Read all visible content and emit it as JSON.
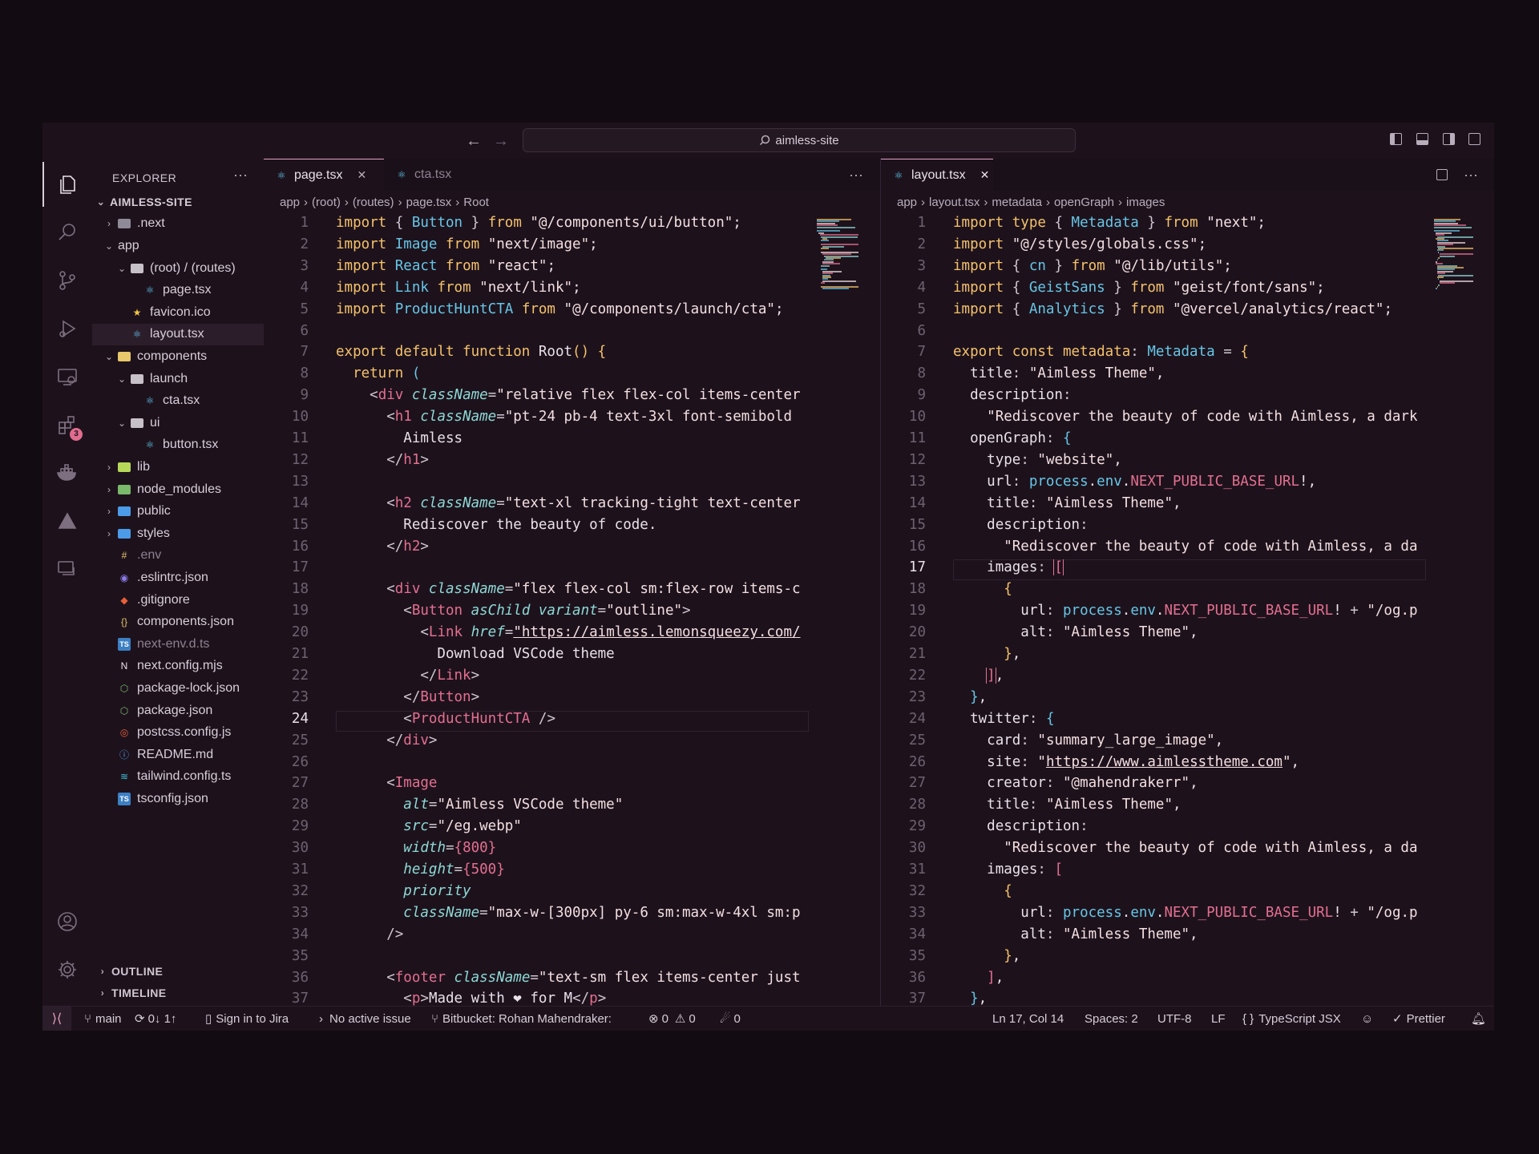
{
  "window": {
    "search_text": "aimless-site"
  },
  "explorer": {
    "title": "EXPLORER",
    "root": "AIMLESS-SITE",
    "outline": "OUTLINE",
    "timeline": "TIMELINE",
    "items": [
      {
        "label": ".next",
        "depth": 0,
        "chev": "›",
        "icon": "folder",
        "color": "#8e8a98"
      },
      {
        "label": "app",
        "depth": 0,
        "chev": "⌄",
        "icon": "none",
        "color": ""
      },
      {
        "label": "(root) / (routes)",
        "depth": 1,
        "chev": "⌄",
        "icon": "folder",
        "color": "#c8c0c8"
      },
      {
        "label": "page.tsx",
        "depth": 2,
        "chev": "",
        "icon": "react",
        "color": "#61c3e8"
      },
      {
        "label": "favicon.ico",
        "depth": 1,
        "chev": "",
        "icon": "star",
        "color": "#f5c542"
      },
      {
        "label": "layout.tsx",
        "depth": 1,
        "chev": "",
        "icon": "react",
        "color": "#61c3e8",
        "selected": true
      },
      {
        "label": "components",
        "depth": 0,
        "chev": "⌄",
        "icon": "folder",
        "color": "#e8c86a"
      },
      {
        "label": "launch",
        "depth": 1,
        "chev": "⌄",
        "icon": "folder",
        "color": "#c8c0c8"
      },
      {
        "label": "cta.tsx",
        "depth": 2,
        "chev": "",
        "icon": "react",
        "color": "#61c3e8"
      },
      {
        "label": "ui",
        "depth": 1,
        "chev": "⌄",
        "icon": "folder",
        "color": "#c8c0c8"
      },
      {
        "label": "button.tsx",
        "depth": 2,
        "chev": "",
        "icon": "react",
        "color": "#61c3e8"
      },
      {
        "label": "lib",
        "depth": 0,
        "chev": "›",
        "icon": "folder",
        "color": "#b6d85a"
      },
      {
        "label": "node_modules",
        "depth": 0,
        "chev": "›",
        "icon": "folder",
        "color": "#7ab86a"
      },
      {
        "label": "public",
        "depth": 0,
        "chev": "›",
        "icon": "folder",
        "color": "#4c9be8"
      },
      {
        "label": "styles",
        "depth": 0,
        "chev": "›",
        "icon": "folder",
        "color": "#4c9be8"
      },
      {
        "label": ".env",
        "depth": 0,
        "chev": "",
        "icon": "hash",
        "color": "#e8c86a",
        "dim": true
      },
      {
        "label": ".eslintrc.json",
        "depth": 0,
        "chev": "",
        "icon": "circle",
        "color": "#8a7ce8"
      },
      {
        "label": ".gitignore",
        "depth": 0,
        "chev": "",
        "icon": "diamond",
        "color": "#e8603a"
      },
      {
        "label": "components.json",
        "depth": 0,
        "chev": "",
        "icon": "braces",
        "color": "#e8c86a"
      },
      {
        "label": "next-env.d.ts",
        "depth": 0,
        "chev": "",
        "icon": "ts",
        "color": "#3b7fc4",
        "dim": true
      },
      {
        "label": "next.config.mjs",
        "depth": 0,
        "chev": "",
        "icon": "n",
        "color": "#e8e0ea"
      },
      {
        "label": "package-lock.json",
        "depth": 0,
        "chev": "",
        "icon": "node",
        "color": "#7ab86a"
      },
      {
        "label": "package.json",
        "depth": 0,
        "chev": "",
        "icon": "node",
        "color": "#7ab86a"
      },
      {
        "label": "postcss.config.js",
        "depth": 0,
        "chev": "",
        "icon": "postcss",
        "color": "#e8603a"
      },
      {
        "label": "README.md",
        "depth": 0,
        "chev": "",
        "icon": "info",
        "color": "#4c9be8"
      },
      {
        "label": "tailwind.config.ts",
        "depth": 0,
        "chev": "",
        "icon": "wave",
        "color": "#3bc0d8"
      },
      {
        "label": "tsconfig.json",
        "depth": 0,
        "chev": "",
        "icon": "ts",
        "color": "#3b7fc4"
      }
    ]
  },
  "activity": {
    "badge_count": "3"
  },
  "left_editor": {
    "tabs": [
      {
        "label": "page.tsx",
        "active": true
      },
      {
        "label": "cta.tsx",
        "active": false
      }
    ],
    "breadcrumb": [
      "app",
      "(root)",
      "(routes)",
      "page.tsx",
      "Root"
    ],
    "current_line": 24,
    "lines": [
      "<span class=\"k\">import</span> <span class=\"p\">{</span> <span class=\"i\">Button</span> <span class=\"p\">}</span> <span class=\"k\">from</span> <span class=\"s\">\"@/components/ui/button\"</span>;",
      "<span class=\"k\">import</span> <span class=\"i\">Image</span> <span class=\"k\">from</span> <span class=\"s\">\"next/image\"</span>;",
      "<span class=\"k\">import</span> <span class=\"i\">React</span> <span class=\"k\">from</span> <span class=\"s\">\"react\"</span>;",
      "<span class=\"k\">import</span> <span class=\"i\">Link</span> <span class=\"k\">from</span> <span class=\"s\">\"next/link\"</span>;",
      "<span class=\"k\">import</span> <span class=\"i\">ProductHuntCTA</span> <span class=\"k\">from</span> <span class=\"s\">\"@/components/launch/cta\"</span>;",
      "",
      "<span class=\"k\">export default function</span> <span class=\"f\">Root</span><span class=\"c\">()</span> <span class=\"c\">{</span>",
      "  <span class=\"k\">return</span> <span class=\"i\">(</span>",
      "    <span class=\"p\">&lt;</span><span class=\"t\">div</span> <span class=\"a\">className</span><span class=\"p\">=</span><span class=\"s\">\"relative flex flex-col items-center</span>",
      "      <span class=\"p\">&lt;</span><span class=\"t\">h1</span> <span class=\"a\">className</span><span class=\"p\">=</span><span class=\"s\">\"pt-24 pb-4 text-3xl font-semibold</span>",
      "        Aimless",
      "      <span class=\"p\">&lt;/</span><span class=\"t\">h1</span><span class=\"p\">&gt;</span>",
      "",
      "      <span class=\"p\">&lt;</span><span class=\"t\">h2</span> <span class=\"a\">className</span><span class=\"p\">=</span><span class=\"s\">\"text-xl tracking-tight text-center</span>",
      "        Rediscover the beauty of code.",
      "      <span class=\"p\">&lt;/</span><span class=\"t\">h2</span><span class=\"p\">&gt;</span>",
      "",
      "      <span class=\"p\">&lt;</span><span class=\"t\">div</span> <span class=\"a\">className</span><span class=\"p\">=</span><span class=\"s\">\"flex flex-col sm:flex-row items-c</span>",
      "        <span class=\"p\">&lt;</span><span class=\"t\">Button</span> <span class=\"a\">asChild variant</span><span class=\"p\">=</span><span class=\"s\">\"outline\"</span><span class=\"p\">&gt;</span>",
      "          <span class=\"p\">&lt;</span><span class=\"t\">Link</span> <span class=\"a\">href</span><span class=\"p\">=</span><span class=\"s\" style=\"text-decoration:underline\">\"https://aimless.lemonsqueezy.com/</span>",
      "            Download VSCode theme",
      "          <span class=\"p\">&lt;/</span><span class=\"t\">Link</span><span class=\"p\">&gt;</span>",
      "        <span class=\"p\">&lt;/</span><span class=\"t\">Button</span><span class=\"p\">&gt;</span>",
      "        <span class=\"p\">&lt;</span><span class=\"t\">ProductHuntCTA</span> <span class=\"p\">/&gt;</span>",
      "      <span class=\"p\">&lt;/</span><span class=\"t\">div</span><span class=\"p\">&gt;</span>",
      "",
      "      <span class=\"p\">&lt;</span><span class=\"t\">Image</span>",
      "        <span class=\"a\">alt</span><span class=\"p\">=</span><span class=\"s\">\"Aimless VSCode theme\"</span>",
      "        <span class=\"a\">src</span><span class=\"p\">=</span><span class=\"s\">\"/eg.webp\"</span>",
      "        <span class=\"a\">width</span><span class=\"p\">=</span><span class=\"t\">{800}</span>",
      "        <span class=\"a\">height</span><span class=\"p\">=</span><span class=\"t\">{500}</span>",
      "        <span class=\"a\">priority</span>",
      "        <span class=\"a\">className</span><span class=\"p\">=</span><span class=\"s\">\"max-w-[300px] py-6 sm:max-w-4xl sm:p</span>",
      "      <span class=\"p\">/&gt;</span>",
      "",
      "      <span class=\"p\">&lt;</span><span class=\"t\">footer</span> <span class=\"a\">className</span><span class=\"p\">=</span><span class=\"s\">\"text-sm flex items-center just</span>",
      "        <span class=\"p\">&lt;</span><span class=\"t\">p</span><span class=\"p\">&gt;</span>Made with ❤ for M<span class=\"p\">&lt;/</span><span class=\"t\">p</span><span class=\"p\">&gt;</span>"
    ]
  },
  "right_editor": {
    "tabs": [
      {
        "label": "layout.tsx",
        "active": true
      }
    ],
    "breadcrumb": [
      "app",
      "layout.tsx",
      "metadata",
      "openGraph",
      "images"
    ],
    "current_line": 17,
    "lines": [
      "<span class=\"k\">import type</span> <span class=\"p\">{</span> <span class=\"i\">Metadata</span> <span class=\"p\">}</span> <span class=\"k\">from</span> <span class=\"s\">\"next\"</span>;",
      "<span class=\"k\">import</span> <span class=\"s\">\"@/styles/globals.css\"</span>;",
      "<span class=\"k\">import</span> <span class=\"p\">{</span> <span class=\"i\">cn</span> <span class=\"p\">}</span> <span class=\"k\">from</span> <span class=\"s\">\"@/lib/utils\"</span>;",
      "<span class=\"k\">import</span> <span class=\"p\">{</span> <span class=\"i\">GeistSans</span> <span class=\"p\">}</span> <span class=\"k\">from</span> <span class=\"s\">\"geist/font/sans\"</span>;",
      "<span class=\"k\">import</span> <span class=\"p\">{</span> <span class=\"i\">Analytics</span> <span class=\"p\">}</span> <span class=\"k\">from</span> <span class=\"s\">\"@vercel/analytics/react\"</span>;",
      "",
      "<span class=\"k\">export const</span> <span class=\"c\">metadata</span><span class=\"p\">:</span> <span class=\"i\">Metadata</span> <span class=\"p\">=</span> <span class=\"c\">{</span>",
      "  <span class=\"f\">title</span><span class=\"p\">:</span> <span class=\"s\">\"Aimless Theme\"</span>,",
      "  <span class=\"f\">description</span><span class=\"p\">:</span>",
      "    <span class=\"s\">\"Rediscover the beauty of code with Aimless, a dark</span>",
      "  <span class=\"f\">openGraph</span><span class=\"p\">:</span> <span class=\"i\">{</span>",
      "    <span class=\"f\">type</span><span class=\"p\">:</span> <span class=\"s\">\"website\"</span>,",
      "    <span class=\"f\">url</span><span class=\"p\">:</span> <span class=\"i\">process</span>.<span class=\"i\">env</span>.<span class=\"t\">NEXT_PUBLIC_BASE_URL</span>!,",
      "    <span class=\"f\">title</span><span class=\"p\">:</span> <span class=\"s\">\"Aimless Theme\"</span>,",
      "    <span class=\"f\">description</span><span class=\"p\">:</span>",
      "      <span class=\"s\">\"Rediscover the beauty of code with Aimless, a da</span>",
      "    <span class=\"f\">images</span><span class=\"p\">:</span> <span class=\"t\" style=\"outline:1px solid #e46f8f\">[</span>",
      "      <span class=\"k\">{</span>",
      "        <span class=\"f\">url</span><span class=\"p\">:</span> <span class=\"i\">process</span>.<span class=\"i\">env</span>.<span class=\"t\">NEXT_PUBLIC_BASE_URL</span>! <span class=\"p\">+</span> <span class=\"s\">\"/og.p</span>",
      "        <span class=\"f\">alt</span><span class=\"p\">:</span> <span class=\"s\">\"Aimless Theme\"</span>,",
      "      <span class=\"k\">}</span>,",
      "    <span class=\"t\" style=\"outline:1px solid #e46f8f\">]</span>,",
      "  <span class=\"i\">}</span>,",
      "  <span class=\"f\">twitter</span><span class=\"p\">:</span> <span class=\"i\">{</span>",
      "    <span class=\"f\">card</span><span class=\"p\">:</span> <span class=\"s\">\"summary_large_image\"</span>,",
      "    <span class=\"f\">site</span><span class=\"p\">:</span> <span class=\"s\">\"<u>https://www.aimlesstheme.com</u>\"</span>,",
      "    <span class=\"f\">creator</span><span class=\"p\">:</span> <span class=\"s\">\"@mahendrakerr\"</span>,",
      "    <span class=\"f\">title</span><span class=\"p\">:</span> <span class=\"s\">\"Aimless Theme\"</span>,",
      "    <span class=\"f\">description</span><span class=\"p\">:</span>",
      "      <span class=\"s\">\"Rediscover the beauty of code with Aimless, a da</span>",
      "    <span class=\"f\">images</span><span class=\"p\">:</span> <span class=\"t\">[</span>",
      "      <span class=\"k\">{</span>",
      "        <span class=\"f\">url</span><span class=\"p\">:</span> <span class=\"i\">process</span>.<span class=\"i\">env</span>.<span class=\"t\">NEXT_PUBLIC_BASE_URL</span>! <span class=\"p\">+</span> <span class=\"s\">\"/og.p</span>",
      "        <span class=\"f\">alt</span><span class=\"p\">:</span> <span class=\"s\">\"Aimless Theme\"</span>,",
      "      <span class=\"k\">}</span>,",
      "    <span class=\"t\">]</span>,",
      "  <span class=\"i\">}</span>,"
    ]
  },
  "status": {
    "branch": "main",
    "sync": "0↓ 1↑",
    "jira": "Sign in to Jira",
    "issue": "No active issue",
    "bitbucket": "Bitbucket: Rohan Mahendraker:",
    "errors": "0",
    "warnings": "0",
    "ports": "0",
    "position": "Ln 17, Col 14",
    "spaces": "Spaces: 2",
    "encoding": "UTF-8",
    "eol": "LF",
    "language": "TypeScript JSX",
    "formatter": "Prettier"
  },
  "colors": {
    "background": "#1d121c",
    "accent": "#e5a0c0",
    "keyword": "#f5c26b",
    "identifier": "#67c6e6",
    "tag": "#e46f8f"
  }
}
